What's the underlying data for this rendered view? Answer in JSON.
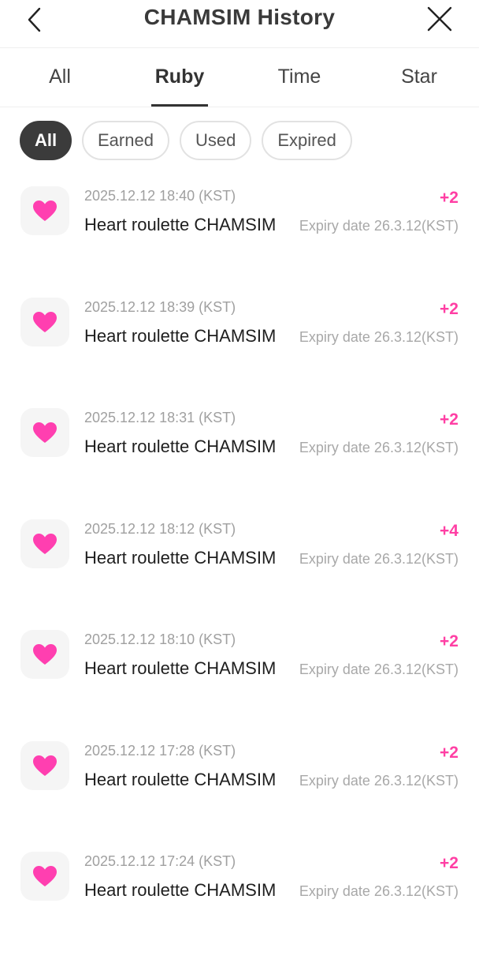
{
  "header": {
    "title": "CHAMSIM History",
    "back_icon": "chevron-left-icon",
    "close_icon": "close-icon"
  },
  "tabs": [
    {
      "label": "All",
      "active": false
    },
    {
      "label": "Ruby",
      "active": true
    },
    {
      "label": "Time",
      "active": false
    },
    {
      "label": "Star",
      "active": false
    }
  ],
  "filters": [
    {
      "label": "All",
      "active": true
    },
    {
      "label": "Earned",
      "active": false
    },
    {
      "label": "Used",
      "active": false
    },
    {
      "label": "Expired",
      "active": false
    }
  ],
  "colors": {
    "accent": "#ff3fa4",
    "heart": "#ff3fb0",
    "chip_active": "#3b3b3b"
  },
  "history": [
    {
      "date": "2025.12.12 18:40 (KST)",
      "name": "Heart roulette CHAMSIM",
      "amount": "+2",
      "expiry": "Expiry date 26.3.12(KST)",
      "icon": "heart-icon"
    },
    {
      "date": "2025.12.12 18:39 (KST)",
      "name": "Heart roulette CHAMSIM",
      "amount": "+2",
      "expiry": "Expiry date 26.3.12(KST)",
      "icon": "heart-icon"
    },
    {
      "date": "2025.12.12 18:31 (KST)",
      "name": "Heart roulette CHAMSIM",
      "amount": "+2",
      "expiry": "Expiry date 26.3.12(KST)",
      "icon": "heart-icon"
    },
    {
      "date": "2025.12.12 18:12 (KST)",
      "name": "Heart roulette CHAMSIM",
      "amount": "+4",
      "expiry": "Expiry date 26.3.12(KST)",
      "icon": "heart-icon"
    },
    {
      "date": "2025.12.12 18:10 (KST)",
      "name": "Heart roulette CHAMSIM",
      "amount": "+2",
      "expiry": "Expiry date 26.3.12(KST)",
      "icon": "heart-icon"
    },
    {
      "date": "2025.12.12 17:28 (KST)",
      "name": "Heart roulette CHAMSIM",
      "amount": "+2",
      "expiry": "Expiry date 26.3.12(KST)",
      "icon": "heart-icon"
    },
    {
      "date": "2025.12.12 17:24 (KST)",
      "name": "Heart roulette CHAMSIM",
      "amount": "+2",
      "expiry": "Expiry date 26.3.12(KST)",
      "icon": "heart-icon"
    }
  ]
}
